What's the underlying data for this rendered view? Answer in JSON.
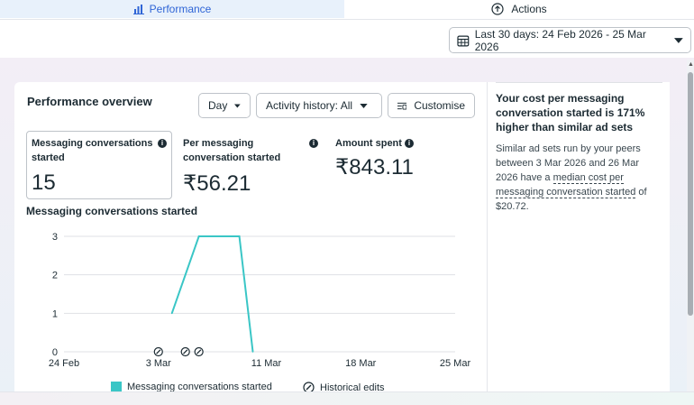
{
  "tabs": {
    "performance": "Performance",
    "actions": "Actions"
  },
  "date_range": {
    "label": "Last 30 days: 24 Feb 2026 - 25 Mar 2026"
  },
  "overview": {
    "title": "Performance overview",
    "granularity": "Day",
    "activity_history": "Activity history: All",
    "customise": "Customise"
  },
  "metrics": [
    {
      "label": "Messaging conversations started",
      "value": "15"
    },
    {
      "label": "Per messaging conversation started",
      "value": "₹56.21"
    },
    {
      "label": "Amount spent",
      "value": "₹843.11"
    }
  ],
  "chart_data": {
    "type": "line",
    "title": "Messaging conversations started",
    "x_ticks": [
      "24 Feb",
      "3 Mar",
      "11 Mar",
      "18 Mar",
      "25 Mar"
    ],
    "y_ticks": [
      0,
      1,
      2,
      3
    ],
    "ylim": [
      0,
      3
    ],
    "xlim": [
      "24 Feb",
      "25 Mar"
    ],
    "grid": true,
    "series": [
      {
        "name": "Messaging conversations started",
        "color": "#3ac6c6",
        "x": [
          "4 Mar",
          "6 Mar",
          "7 Mar",
          "8 Mar",
          "9 Mar",
          "10 Mar"
        ],
        "y": [
          1,
          3,
          3,
          3,
          3,
          0
        ]
      }
    ],
    "historical_edits": [
      "3 Mar",
      "5 Mar",
      "6 Mar"
    ],
    "legend": {
      "series_label": "Messaging conversations started",
      "edits_label": "Historical edits"
    }
  },
  "insight": {
    "title": "Your cost per messaging conversation started is 171% higher than similar ad sets",
    "body_prefix": "Similar ad sets run by your peers between 3 Mar 2026 and 26 Mar 2026 have a ",
    "body_link": "median cost per messaging conversation started",
    "body_suffix": " of $20.72."
  },
  "icons": {
    "performance": "bar-chart-icon",
    "actions": "upload-icon",
    "calendar": "calendar-icon",
    "info": "info-icon",
    "customise": "customise-icon",
    "historical_edit": "edit-history-icon"
  },
  "colors": {
    "accent": "#2f65d6",
    "series": "#3ac6c6"
  }
}
